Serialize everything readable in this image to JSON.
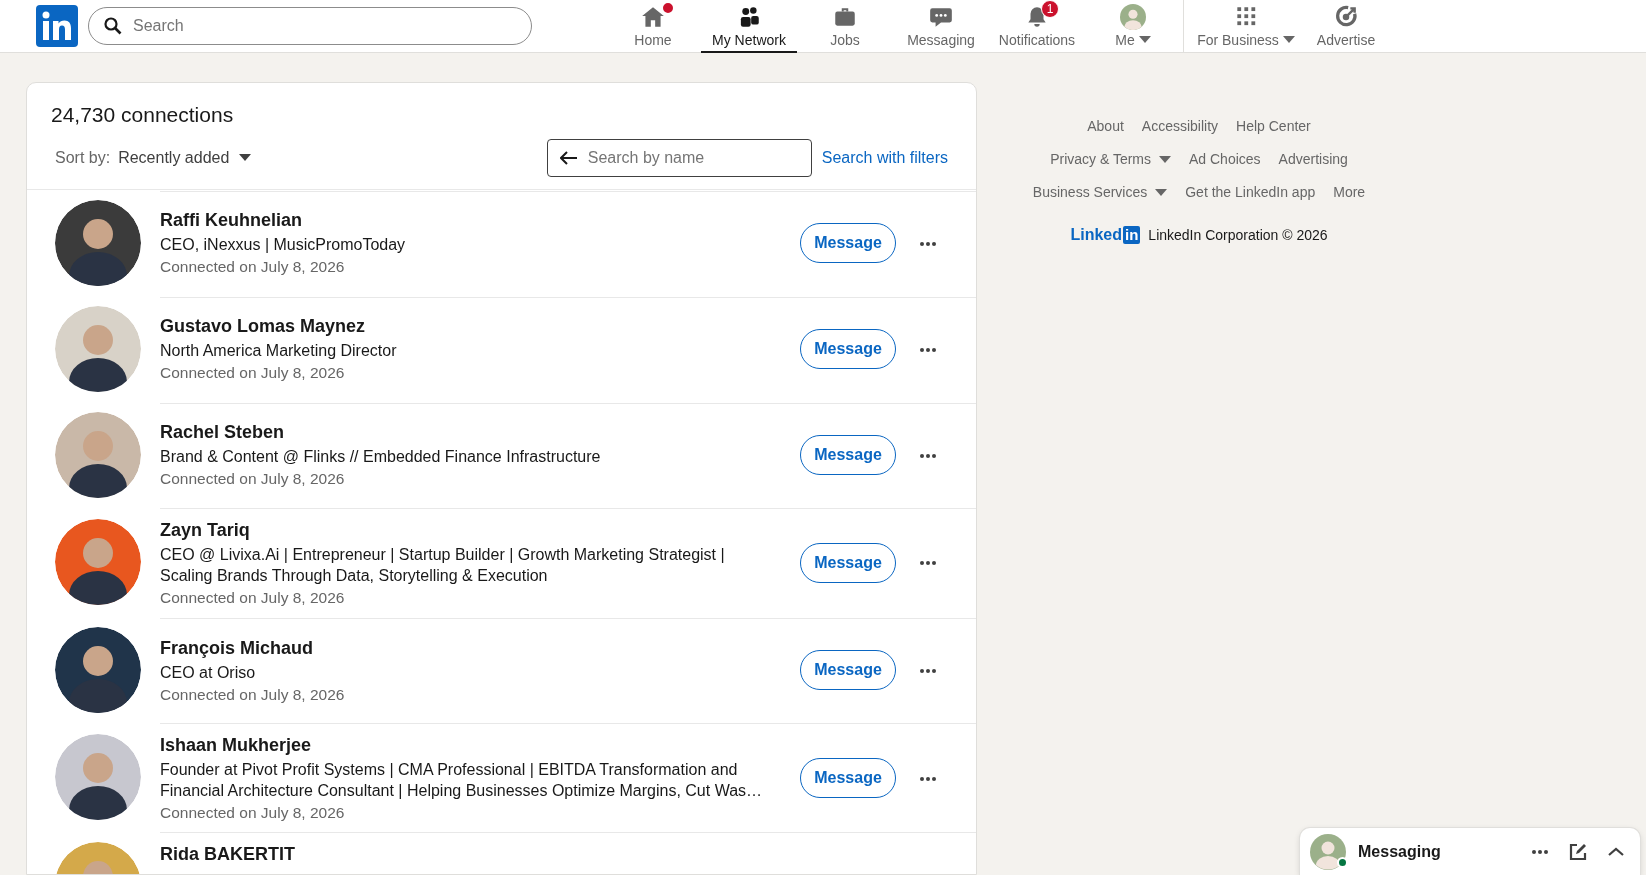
{
  "nav": {
    "search": {
      "placeholder": "Search"
    },
    "items": [
      {
        "label": "Home",
        "selected": false,
        "notice": true
      },
      {
        "label": "My Network",
        "selected": true
      },
      {
        "label": "Jobs",
        "selected": false
      },
      {
        "label": "Messaging",
        "selected": false
      },
      {
        "label": "Notifications",
        "selected": false,
        "badge": "1"
      },
      {
        "label": "Me",
        "selected": false,
        "dropdown": true
      }
    ],
    "extra": [
      {
        "label": "For Business",
        "dropdown": true
      },
      {
        "label": "Advertise",
        "dropdown": false
      }
    ]
  },
  "connections": {
    "title": "24,730 connections",
    "sort_label": "Sort by:",
    "sort_value": "Recently added",
    "search": {
      "placeholder": "Search by name"
    },
    "filters_link": "Search with filters",
    "rows": [
      {
        "name": "Raffi Keuhnelian",
        "headline": "CEO, iNexxus | MusicPromoToday",
        "connected": "Connected on July 8, 2026",
        "button": "Message"
      },
      {
        "name": "Gustavo Lomas Maynez",
        "headline": "North America Marketing Director",
        "connected": "Connected on July 8, 2026",
        "button": "Message"
      },
      {
        "name": "Rachel Steben",
        "headline": "Brand & Content @ Flinks // Embedded Finance Infrastructure",
        "connected": "Connected on July 8, 2026",
        "button": "Message"
      },
      {
        "name": "Zayn Tariq",
        "headline": "CEO @ Livixa.Ai | Entrepreneur | Startup Builder | Growth Marketing Strategist | Scaling Brands Through Data, Storytelling & Execution",
        "connected": "Connected on July 8, 2026",
        "button": "Message"
      },
      {
        "name": "François Michaud",
        "headline": "CEO at Oriso",
        "connected": "Connected on July 8, 2026",
        "button": "Message"
      },
      {
        "name": "Ishaan Mukherjee",
        "headline": "Founder at Pivot Profit Systems | CMA Professional | EBITDA Transformation and Financial Architecture Consultant | Helping Businesses Optimize Margins, Cut Was…",
        "connected": "Connected on July 8, 2026",
        "button": "Message"
      },
      {
        "name": "Rida BAKERTIT"
      }
    ]
  },
  "footer": {
    "links": [
      [
        {
          "label": "About",
          "dropdown": false
        },
        {
          "label": "Accessibility",
          "dropdown": false
        },
        {
          "label": "Help Center",
          "dropdown": false
        }
      ],
      [
        {
          "label": "Privacy & Terms",
          "dropdown": true
        },
        {
          "label": "Ad Choices",
          "dropdown": false
        },
        {
          "label": "Advertising",
          "dropdown": false
        }
      ],
      [
        {
          "label": "Business Services",
          "dropdown": true
        },
        {
          "label": "Get the LinkedIn app",
          "dropdown": false
        },
        {
          "label": "More",
          "dropdown": false
        }
      ]
    ],
    "brand": "Linked",
    "brand_box": "in",
    "copyright": "LinkedIn Corporation © 2026"
  },
  "messaging": {
    "title": "Messaging",
    "online": true
  }
}
